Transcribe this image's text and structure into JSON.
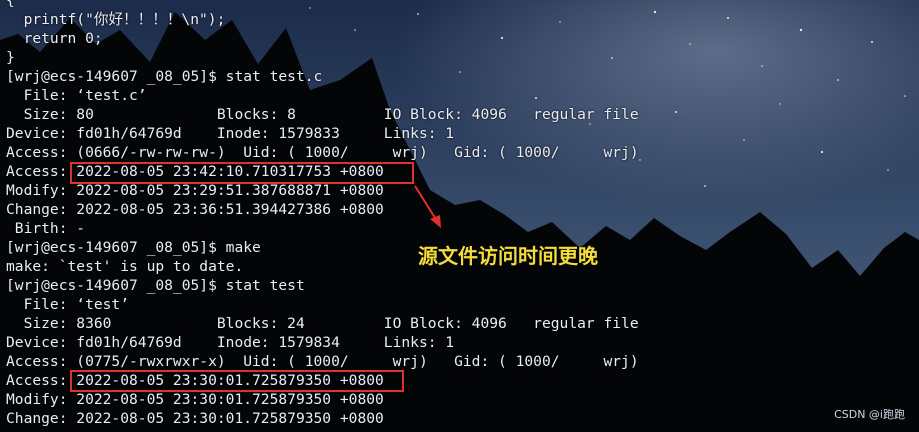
{
  "terminal": {
    "lines": [
      "{",
      "  printf(\"你好！！！！\\n\");",
      "  return 0;",
      "}",
      "[wrj@ecs-149607 _08_05]$ stat test.c",
      "  File: ‘test.c’",
      "  Size: 80              Blocks: 8          IO Block: 4096   regular file",
      "Device: fd01h/64769d    Inode: 1579833     Links: 1",
      "Access: (0666/-rw-rw-rw-)  Uid: ( 1000/     wrj)   Gid: ( 1000/     wrj)",
      "Access: 2022-08-05 23:42:10.710317753 +0800",
      "Modify: 2022-08-05 23:29:51.387688871 +0800",
      "Change: 2022-08-05 23:36:51.394427386 +0800",
      " Birth: -",
      "[wrj@ecs-149607 _08_05]$ make",
      "make: `test' is up to date.",
      "[wrj@ecs-149607 _08_05]$ stat test",
      "  File: ‘test’",
      "  Size: 8360            Blocks: 24         IO Block: 4096   regular file",
      "Device: fd01h/64769d    Inode: 1579834     Links: 1",
      "Access: (0775/-rwxrwxr-x)  Uid: ( 1000/     wrj)   Gid: ( 1000/     wrj)",
      "Access: 2022-08-05 23:30:01.725879350 +0800",
      "Modify: 2022-08-05 23:30:01.725879350 +0800",
      "Change: 2022-08-05 23:30:01.725879350 +0800"
    ]
  },
  "annotation": {
    "text": "源文件访问时间更晚"
  },
  "watermark": {
    "text": "CSDN @i跑跑"
  },
  "colors": {
    "terminal_text": "#e9eef5",
    "highlight_box": "#e0322b",
    "annotation_text": "#f4dc3a",
    "sky_top": "#1b2a48",
    "silhouette": "#040507"
  }
}
